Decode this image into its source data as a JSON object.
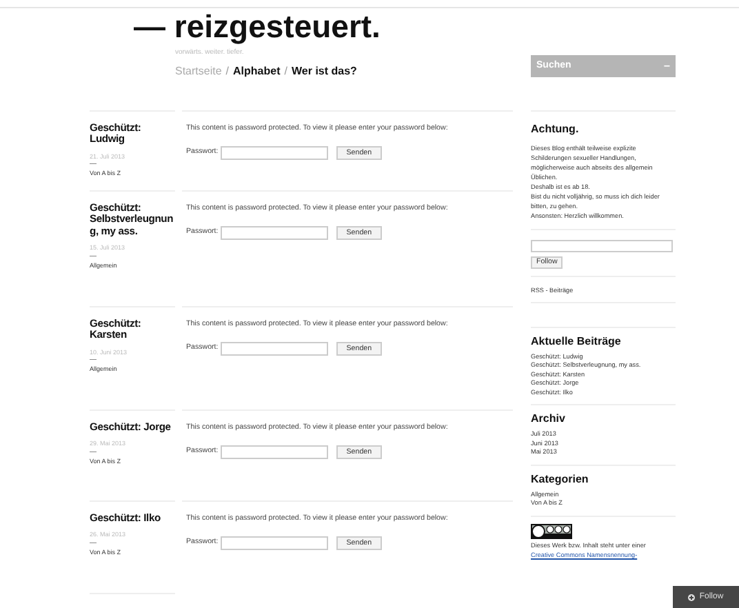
{
  "site": {
    "title": "— reizgesteuert.",
    "tagline": "vorwärts. weiter. tiefer."
  },
  "nav": [
    {
      "label": "Startseite",
      "selected": false
    },
    {
      "label": "Alphabet",
      "selected": true
    },
    {
      "label": "Wer ist das?",
      "selected": true
    }
  ],
  "nav_separator": "/",
  "search": {
    "label": "Suchen",
    "toggle": "–"
  },
  "posts": [
    {
      "title": "Geschützt: Ludwig",
      "date": "21. Juli 2013",
      "dash": "—",
      "category": "Von A bis Z",
      "notice": "This content is password protected. To view it please enter your password below:",
      "field_label": "Passwort:",
      "button": "Senden"
    },
    {
      "title": "Geschützt: Selbstverleugnung, my ass.",
      "date": "15. Juli 2013",
      "dash": "—",
      "category": "Allgemein",
      "notice": "This content is password protected. To view it please enter your password below:",
      "field_label": "Passwort:",
      "button": "Senden"
    },
    {
      "title": "Geschützt: Karsten",
      "date": "10. Juni 2013",
      "dash": "—",
      "category": "Allgemein",
      "notice": "This content is password protected. To view it please enter your password below:",
      "field_label": "Passwort:",
      "button": "Senden"
    },
    {
      "title": "Geschützt: Jorge",
      "date": "29. Mai 2013",
      "dash": "—",
      "category": "Von A bis Z",
      "notice": "This content is password protected. To view it please enter your password below:",
      "field_label": "Passwort:",
      "button": "Senden"
    },
    {
      "title": "Geschützt: Ilko",
      "date": "26. Mai 2013",
      "dash": "—",
      "category": "Von A bis Z",
      "notice": "This content is password protected. To view it please enter your password below:",
      "field_label": "Passwort:",
      "button": "Senden"
    }
  ],
  "sidebar": {
    "warning": {
      "title": "Achtung.",
      "lines": [
        "Dieses Blog enthält teilweise explizite Schilderungen sexueller Handlungen, möglicherweise auch abseits des allgemein Üblichen.",
        "Deshalb ist es ab 18.",
        "Bist du nicht volljährig, so muss ich dich leider bitten, zu gehen.",
        "Ansonsten: Herzlich willkommen."
      ]
    },
    "follow_button": "Follow",
    "rss": "RSS - Beiträge",
    "widgets": [
      {
        "title": "Aktuelle Beiträge",
        "items": [
          "Geschützt: Ludwig",
          "Geschützt: Selbstverleugnung, my ass.",
          "Geschützt: Karsten",
          "Geschützt: Jorge",
          "Geschützt: Ilko"
        ]
      },
      {
        "title": "Archiv",
        "items": [
          "Juli 2013",
          "Juni 2013",
          "Mai 2013"
        ]
      },
      {
        "title": "Kategorien",
        "items": [
          "Allgemein",
          "Von A bis Z"
        ]
      }
    ],
    "license_text": "Dieses Werk bzw. Inhalt steht unter einer",
    "license_link": "Creative Commons Namensnennung-"
  },
  "floating_follow": "Follow"
}
